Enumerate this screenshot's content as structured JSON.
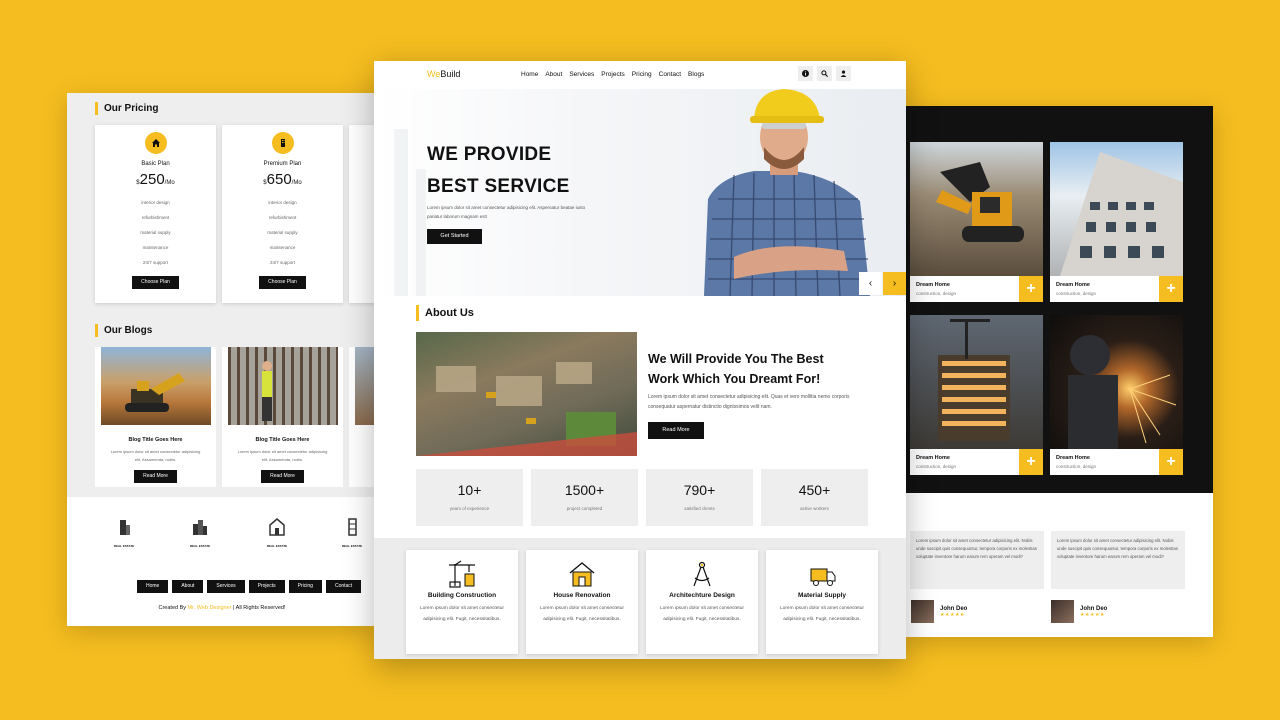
{
  "left": {
    "pricing_title": "Our Pricing",
    "plans": [
      {
        "name": "Basic Plan",
        "currency": "$",
        "price": "250",
        "period": "/Mo",
        "features": [
          "interior design",
          "refurbishment",
          "material supply",
          "maintenance",
          "24/7 support"
        ],
        "button": "Choose Plan"
      },
      {
        "name": "Premium Plan",
        "currency": "$",
        "price": "650",
        "period": "/Mo",
        "features": [
          "interior design",
          "refurbishment",
          "material supply",
          "maintenance",
          "24/7 support"
        ],
        "button": "Choose Plan"
      }
    ],
    "blogs_title": "Our Blogs",
    "blogs": [
      {
        "title": "Blog Title Goes Here",
        "desc": "Lorem ipsum dolor sit amet consectetur adipisicing elit. Assumenda, nobis.",
        "button": "Read More"
      },
      {
        "title": "Blog Title Goes Here",
        "desc": "Lorem ipsum dolor sit amet consectetur adipisicing elit. Assumenda, nobis.",
        "button": "Read More"
      }
    ],
    "partner_logo_text": "REAL ESTATE",
    "footer_nav": [
      "Home",
      "About",
      "Services",
      "Projects",
      "Pricing",
      "Contact"
    ],
    "credit_prefix": "Created By",
    "credit_author": "Mr. Web Designer",
    "credit_suffix": "| All Rights Reserved!"
  },
  "center": {
    "brand_a": "We",
    "brand_b": "Build",
    "menu": [
      "Home",
      "About",
      "Services",
      "Projects",
      "Pricing",
      "Contact",
      "Blogs"
    ],
    "hero_line1": "WE PROVIDE",
    "hero_line2": "BEST SERVICE",
    "hero_desc": "Lorem ipsum dolor sit amet consectetur adipisicing elit. Aspernatur beatae iusto pariatur laborum magnam est!",
    "hero_button": "Get Started",
    "about_title": "About Us",
    "about_heading": "We Will Provide You The Best Work Which You Dreamt For!",
    "about_desc": "Lorem ipsum dolor sit amet consectetur adipisicing elit. Quas et vero mollitia nemo corporis consequatur aspernatur distinctio dignissimos velit nam.",
    "about_button": "Read More",
    "stats": [
      {
        "value": "10+",
        "label": "years of experience"
      },
      {
        "value": "1500+",
        "label": "project completed"
      },
      {
        "value": "790+",
        "label": "satisfied clients"
      },
      {
        "value": "450+",
        "label": "active workers"
      }
    ],
    "services": [
      {
        "icon": "crane-icon",
        "title": "Building Construction",
        "desc": "Lorem ipsum dolor sit amet consectetur adipisicing elit. Fugit, necessitatibus."
      },
      {
        "icon": "house-icon",
        "title": "House Renovation",
        "desc": "Lorem ipsum dolor sit amet consectetur adipisicing elit. Fugit, necessitatibus."
      },
      {
        "icon": "compass-icon",
        "title": "Architechture Design",
        "desc": "Lorem ipsum dolor sit amet consectetur adipisicing elit. Fugit, necessitatibus."
      },
      {
        "icon": "truck-icon",
        "title": "Material Supply",
        "desc": "Lorem ipsum dolor sit amet consectetur adipisicing elit. Fugit, necessitatibus."
      }
    ]
  },
  "right": {
    "projects": [
      {
        "title": "Dream Home",
        "sub": "construction, design"
      },
      {
        "title": "Dream Home",
        "sub": "construction, design"
      },
      {
        "title": "Dream Home",
        "sub": "construction, design"
      },
      {
        "title": "Dream Home",
        "sub": "construction, design"
      }
    ],
    "testimonials": [
      {
        "text": "Lorem ipsum dolor sit amet consectetur adipisicing elit. Nobis unde suscipit quis consequuntur, tempora corporis ex molestias voluptate inventore harum earum rem operam vel modi?",
        "name": "John Deo",
        "stars": "★★★★★"
      },
      {
        "text": "Lorem ipsum dolor sit amet consectetur adipisicing elit. Nobis unde suscipit quis consequuntur, tempora corporis ex molestias voluptate inventore harum earum rem operam vel modi?",
        "name": "John Deo",
        "stars": "★★★★★"
      }
    ]
  },
  "colors": {
    "accent": "#f5bd1f",
    "dark": "#111111",
    "light_bg": "#eeeeee"
  }
}
